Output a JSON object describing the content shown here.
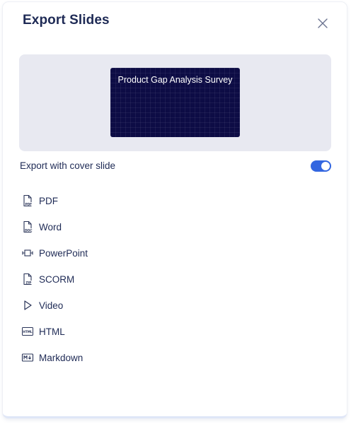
{
  "dialog": {
    "title": "Export Slides",
    "close_icon": "close-icon"
  },
  "preview": {
    "slide_title": "Product Gap Analysis Survey",
    "slide_color": "#0d0c45"
  },
  "cover_slide": {
    "label": "Export with cover slide",
    "enabled": true,
    "accent_color": "#3366e0"
  },
  "formats": [
    {
      "label": "PDF",
      "icon": "pdf-file-icon"
    },
    {
      "label": "Word",
      "icon": "doc-file-icon"
    },
    {
      "label": "PowerPoint",
      "icon": "presentation-icon"
    },
    {
      "label": "SCORM",
      "icon": "zip-file-icon"
    },
    {
      "label": "Video",
      "icon": "play-icon"
    },
    {
      "label": "HTML",
      "icon": "html-icon"
    },
    {
      "label": "Markdown",
      "icon": "markdown-icon"
    }
  ]
}
